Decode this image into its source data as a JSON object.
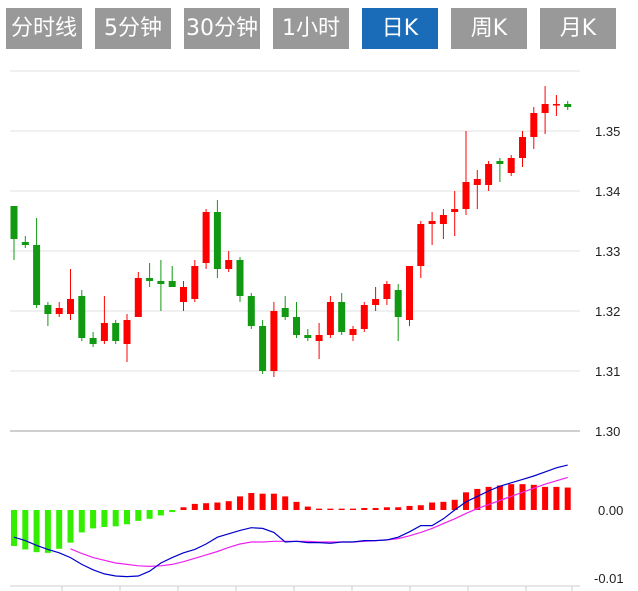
{
  "tabs": [
    {
      "label": "分时线",
      "active": false
    },
    {
      "label": "5分钟",
      "active": false
    },
    {
      "label": "30分钟",
      "active": false
    },
    {
      "label": "1小时",
      "active": false
    },
    {
      "label": "日K",
      "active": true
    },
    {
      "label": "周K",
      "active": false
    },
    {
      "label": "月K",
      "active": false
    }
  ],
  "colors": {
    "tab_bg": "#999999",
    "tab_active": "#1a6bb8",
    "up": "#ff0000",
    "down": "#119911",
    "macd_pos": "#ff0000",
    "macd_neg": "#33ee00",
    "dif": "#0000cc",
    "dea": "#ee22ee"
  },
  "chart_data": [
    {
      "type": "candlestick",
      "price_axis": {
        "ticks": [
          "1.35",
          "1.34",
          "1.33",
          "1.32",
          "1.31",
          "1.30"
        ],
        "ylim": [
          1.3,
          1.36
        ]
      },
      "candles": [
        [
          1.3375,
          1.337,
          1.3285,
          1.332
        ],
        [
          1.3315,
          1.3325,
          1.3305,
          1.331
        ],
        [
          1.331,
          1.3355,
          1.3205,
          1.321
        ],
        [
          1.321,
          1.3215,
          1.3175,
          1.3195
        ],
        [
          1.3195,
          1.3215,
          1.319,
          1.3205
        ],
        [
          1.3195,
          1.327,
          1.3185,
          1.322
        ],
        [
          1.3225,
          1.3235,
          1.315,
          1.3155
        ],
        [
          1.3155,
          1.3165,
          1.314,
          1.3145
        ],
        [
          1.315,
          1.3225,
          1.3145,
          1.318
        ],
        [
          1.318,
          1.3185,
          1.3145,
          1.315
        ],
        [
          1.3145,
          1.3195,
          1.3115,
          1.3185
        ],
        [
          1.319,
          1.3265,
          1.319,
          1.3255
        ],
        [
          1.3255,
          1.328,
          1.324,
          1.325
        ],
        [
          1.325,
          1.3285,
          1.32,
          1.3245
        ],
        [
          1.325,
          1.3275,
          1.324,
          1.324
        ],
        [
          1.3215,
          1.325,
          1.32,
          1.324
        ],
        [
          1.322,
          1.3285,
          1.3215,
          1.3275
        ],
        [
          1.328,
          1.337,
          1.327,
          1.3365
        ],
        [
          1.3365,
          1.3385,
          1.3255,
          1.327
        ],
        [
          1.327,
          1.33,
          1.3265,
          1.3285
        ],
        [
          1.3285,
          1.329,
          1.3215,
          1.3225
        ],
        [
          1.3225,
          1.323,
          1.317,
          1.3175
        ],
        [
          1.3175,
          1.3185,
          1.3095,
          1.31
        ],
        [
          1.31,
          1.3215,
          1.309,
          1.32
        ],
        [
          1.3205,
          1.3225,
          1.3185,
          1.319
        ],
        [
          1.319,
          1.3215,
          1.3155,
          1.316
        ],
        [
          1.316,
          1.317,
          1.315,
          1.3155
        ],
        [
          1.315,
          1.318,
          1.312,
          1.316
        ],
        [
          1.316,
          1.3225,
          1.3155,
          1.3215
        ],
        [
          1.3215,
          1.323,
          1.316,
          1.3165
        ],
        [
          1.316,
          1.3175,
          1.315,
          1.317
        ],
        [
          1.317,
          1.3215,
          1.3165,
          1.321
        ],
        [
          1.321,
          1.324,
          1.32,
          1.322
        ],
        [
          1.322,
          1.325,
          1.321,
          1.3245
        ],
        [
          1.3235,
          1.3245,
          1.315,
          1.319
        ],
        [
          1.3185,
          1.3265,
          1.3175,
          1.3275
        ],
        [
          1.3275,
          1.335,
          1.3255,
          1.3345
        ],
        [
          1.3345,
          1.3365,
          1.331,
          1.335
        ],
        [
          1.3345,
          1.337,
          1.332,
          1.336
        ],
        [
          1.3365,
          1.34,
          1.3325,
          1.337
        ],
        [
          1.337,
          1.35,
          1.336,
          1.3415
        ],
        [
          1.341,
          1.3435,
          1.337,
          1.342
        ],
        [
          1.341,
          1.345,
          1.34,
          1.3445
        ],
        [
          1.345,
          1.3455,
          1.3415,
          1.3445
        ],
        [
          1.343,
          1.346,
          1.3425,
          1.3455
        ],
        [
          1.3455,
          1.35,
          1.344,
          1.349
        ],
        [
          1.349,
          1.354,
          1.347,
          1.353
        ],
        [
          1.353,
          1.3575,
          1.3495,
          1.3545
        ],
        [
          1.3545,
          1.356,
          1.3525,
          1.3545
        ],
        [
          1.3545,
          1.355,
          1.3535,
          1.354
        ]
      ]
    },
    {
      "type": "macd",
      "axis": {
        "ticks": [
          "0.00",
          "-0.01"
        ],
        "ylim": [
          -0.0125,
          0.0095
        ]
      },
      "histogram": [
        -0.0053,
        -0.0058,
        -0.0062,
        -0.0063,
        -0.0057,
        -0.0048,
        -0.0033,
        -0.0027,
        -0.0025,
        -0.0024,
        -0.0021,
        -0.0016,
        -0.0013,
        -0.0008,
        -0.0003,
        0.0004,
        0.0009,
        0.001,
        0.0011,
        0.0013,
        0.002,
        0.0025,
        0.0024,
        0.0024,
        0.002,
        0.0012,
        0.0005,
        0.0002,
        0.0002,
        0.0002,
        0.0002,
        0.0003,
        0.0003,
        0.0004,
        0.0004,
        0.0006,
        0.0007,
        0.0011,
        0.0012,
        0.0015,
        0.0026,
        0.0031,
        0.0034,
        0.0036,
        0.0038,
        0.0038,
        0.0037,
        0.0034,
        0.0034,
        0.0033
      ],
      "dif": [
        -0.004,
        -0.0045,
        -0.0052,
        -0.0058,
        -0.0063,
        -0.007,
        -0.008,
        -0.0088,
        -0.0094,
        -0.0097,
        -0.0098,
        -0.0097,
        -0.009,
        -0.0078,
        -0.007,
        -0.0063,
        -0.0058,
        -0.005,
        -0.004,
        -0.0035,
        -0.003,
        -0.0026,
        -0.0027,
        -0.0033,
        -0.0047,
        -0.0046,
        -0.0048,
        -0.0048,
        -0.0049,
        -0.0047,
        -0.0047,
        -0.0045,
        -0.0045,
        -0.0044,
        -0.004,
        -0.0032,
        -0.0023,
        -0.0023,
        -0.0013,
        0.0,
        0.0012,
        0.002,
        0.0028,
        0.0035,
        0.004,
        0.0045,
        0.005,
        0.0056,
        0.0062,
        0.0066
      ],
      "dea": [
        null,
        null,
        null,
        null,
        null,
        -0.0057,
        -0.0064,
        -0.007,
        -0.0074,
        -0.0078,
        -0.008,
        -0.0082,
        -0.0083,
        -0.0082,
        -0.008,
        -0.0076,
        -0.0071,
        -0.0066,
        -0.0061,
        -0.0055,
        -0.005,
        -0.0047,
        -0.0047,
        -0.0046,
        -0.0046,
        -0.0046,
        -0.0046,
        -0.0047,
        -0.0047,
        -0.0047,
        -0.0047,
        -0.0046,
        -0.0045,
        -0.0044,
        -0.0042,
        -0.0038,
        -0.0033,
        -0.0027,
        -0.002,
        -0.0013,
        -0.0005,
        0.0002,
        0.0008,
        0.0014,
        0.002,
        0.0026,
        0.0032,
        0.0038,
        0.0043,
        0.0048
      ]
    }
  ]
}
